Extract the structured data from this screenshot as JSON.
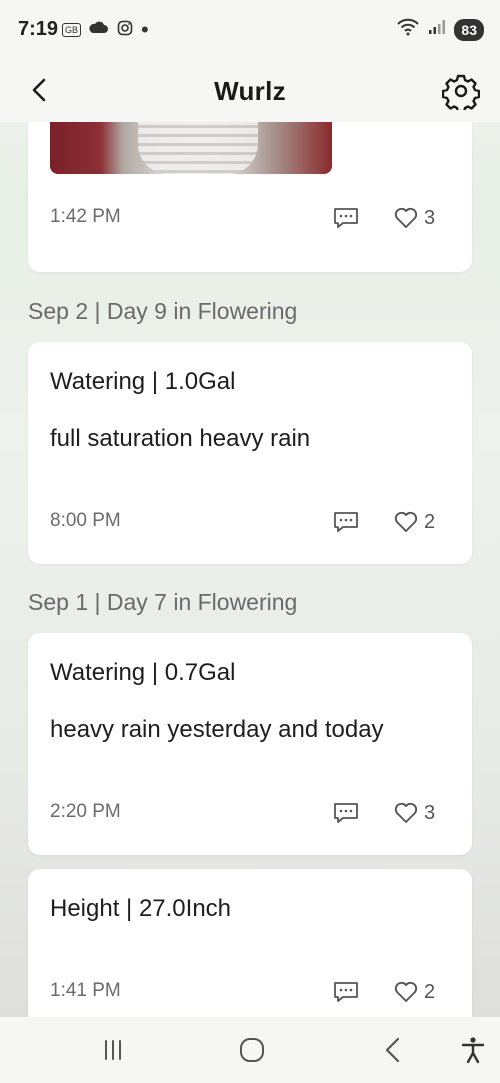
{
  "status_bar": {
    "time": "7:19",
    "battery": "83",
    "icons": [
      "gb-icon",
      "cloud-icon",
      "instagram-icon",
      "dot-icon",
      "wifi-icon",
      "signal-icon"
    ]
  },
  "app_bar": {
    "title": "Wurlz"
  },
  "entries": [
    {
      "time": "1:42 PM",
      "likes": "3"
    },
    {
      "day_header": "Sep 2 | Day 9 in Flowering",
      "title": "Watering | 1.0Gal",
      "note": "full saturation heavy rain",
      "time": "8:00 PM",
      "likes": "2"
    },
    {
      "day_header": "Sep 1 | Day 7 in Flowering",
      "title": "Watering | 0.7Gal",
      "note": "heavy rain yesterday and today",
      "time": "2:20 PM",
      "likes": "3"
    },
    {
      "title": "Height | 27.0Inch",
      "time": "1:41 PM",
      "likes": "2"
    }
  ],
  "colors": {
    "accent_photo_cap": "#2f7c6d",
    "text_muted": "#6b6b6b"
  }
}
